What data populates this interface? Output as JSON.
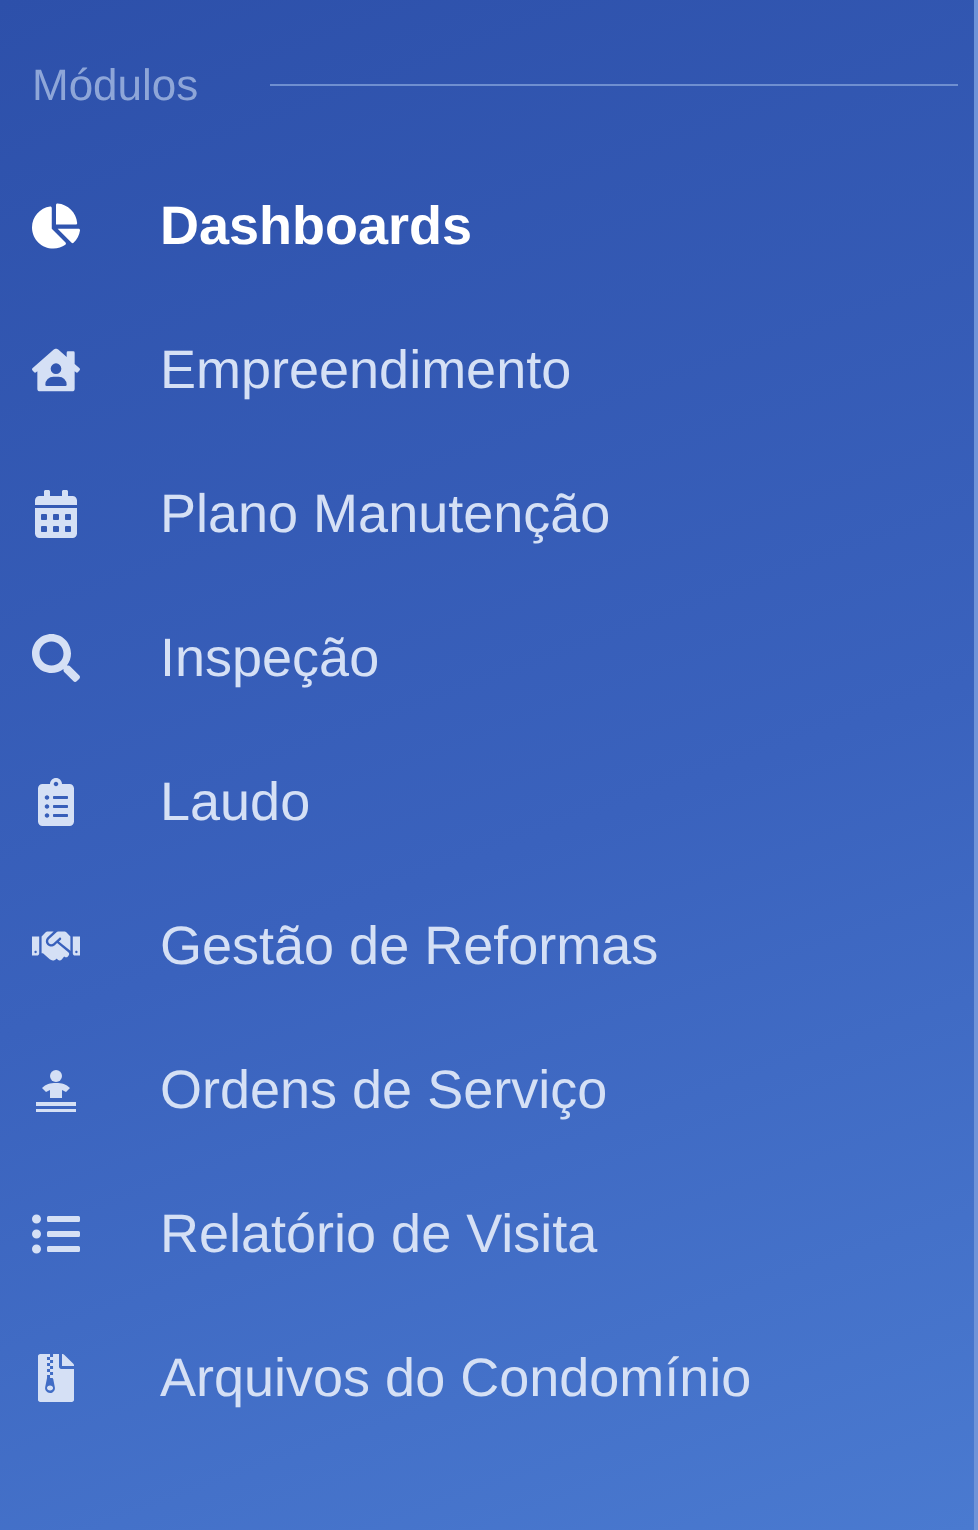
{
  "section": {
    "title": "Módulos"
  },
  "items": [
    {
      "label": "Dashboards",
      "kind": "chart",
      "selected": true
    },
    {
      "label": "Empreendimento",
      "kind": "house",
      "selected": false
    },
    {
      "label": "Plano Manutenção",
      "kind": "calendar",
      "selected": false
    },
    {
      "label": "Inspeção",
      "kind": "search",
      "selected": false
    },
    {
      "label": "Laudo",
      "kind": "clipboard",
      "selected": false
    },
    {
      "label": "Gestão de Reformas",
      "kind": "handshake",
      "selected": false
    },
    {
      "label": "Ordens de Serviço",
      "kind": "worker",
      "selected": false
    },
    {
      "label": "Relatório de Visita",
      "kind": "list",
      "selected": false
    },
    {
      "label": "Arquivos do Condomínio",
      "kind": "archive",
      "selected": false
    }
  ]
}
